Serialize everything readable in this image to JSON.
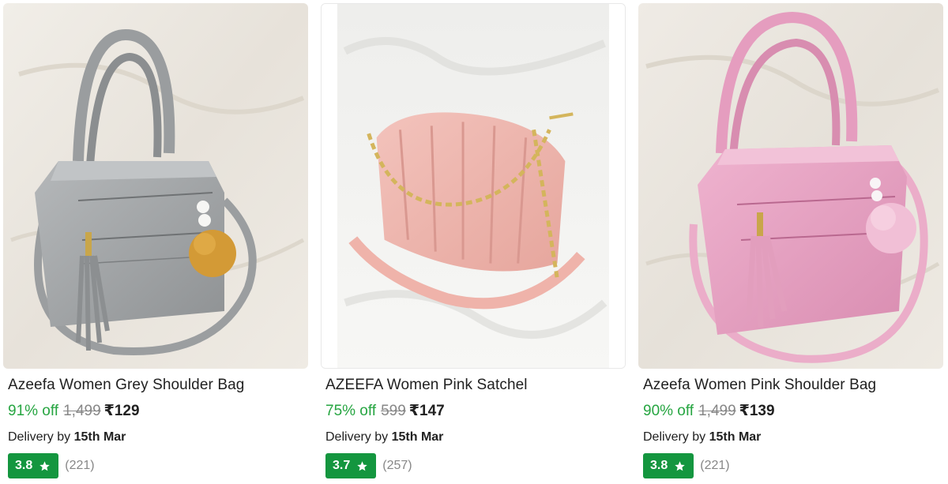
{
  "products": [
    {
      "title": "Azeefa Women Grey Shoulder Bag",
      "discount": "91% off",
      "mrp": "1,499",
      "price": "₹129",
      "delivery_prefix": "Delivery by",
      "delivery_date": "15th Mar",
      "rating": "3.8",
      "reviews": "(221)",
      "bag_color": "#a3a6a8",
      "bg_color": "#ebe7df"
    },
    {
      "title": "AZEEFA Women Pink Satchel",
      "discount": "75% off",
      "mrp": "599",
      "price": "₹147",
      "delivery_prefix": "Delivery by",
      "delivery_date": "15th Mar",
      "rating": "3.7",
      "reviews": "(257)",
      "bag_color": "#efb9b2",
      "bg_color": "#f3f3f1"
    },
    {
      "title": "Azeefa Women Pink Shoulder Bag",
      "discount": "90% off",
      "mrp": "1,499",
      "price": "₹139",
      "delivery_prefix": "Delivery by",
      "delivery_date": "15th Mar",
      "rating": "3.8",
      "reviews": "(221)",
      "bag_color": "#e9a9c6",
      "bg_color": "#ece8e1"
    }
  ],
  "colors": {
    "discount_green": "#26a541",
    "rating_green": "#14963f",
    "muted_grey": "#878787"
  },
  "icons": {
    "rating": "star-icon"
  }
}
